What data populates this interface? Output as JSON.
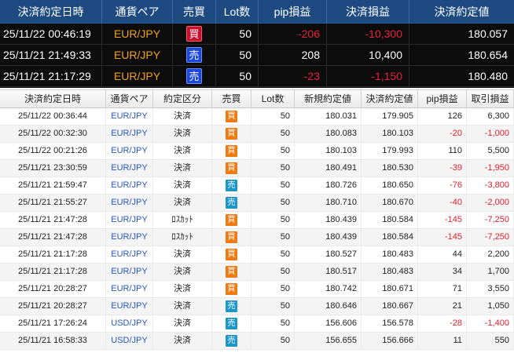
{
  "open_positions": {
    "headers": [
      "決済約定日時",
      "通貨ペア",
      "売買",
      "Lot数",
      "pip損益",
      "決済損益",
      "決済約定値"
    ],
    "rows": [
      {
        "datetime": "25/11/22 00:46:19",
        "pair": "EUR/JPY",
        "side": "買",
        "side_type": "buy",
        "lot": "50",
        "pip": "-206",
        "pnl": "-10,300",
        "price": "180.057",
        "negative": true
      },
      {
        "datetime": "25/11/21 21:49:33",
        "pair": "EUR/JPY",
        "side": "売",
        "side_type": "sell",
        "lot": "50",
        "pip": "208",
        "pnl": "10,400",
        "price": "180.654",
        "negative": false
      },
      {
        "datetime": "25/11/21 21:17:29",
        "pair": "EUR/JPY",
        "side": "売",
        "side_type": "sell",
        "lot": "50",
        "pip": "-23",
        "pnl": "-1,150",
        "price": "180.480",
        "negative": true
      }
    ]
  },
  "history": {
    "headers": [
      "決済約定日時",
      "通貨ペア",
      "約定区分",
      "売買",
      "Lot数",
      "新規約定値",
      "決済約定値",
      "pip損益",
      "取引損益"
    ],
    "rows": [
      {
        "datetime": "25/11/22 00:36:44",
        "pair": "EUR/JPY",
        "kind": "決済",
        "side": "買",
        "side_type": "buy",
        "lot": "50",
        "open": "180.031",
        "close": "179.905",
        "pip": "126",
        "pnl": "6,300",
        "negative": false
      },
      {
        "datetime": "25/11/22 00:32:30",
        "pair": "EUR/JPY",
        "kind": "決済",
        "side": "買",
        "side_type": "buy",
        "lot": "50",
        "open": "180.083",
        "close": "180.103",
        "pip": "-20",
        "pnl": "-1,000",
        "negative": true
      },
      {
        "datetime": "25/11/22 00:21:26",
        "pair": "EUR/JPY",
        "kind": "決済",
        "side": "買",
        "side_type": "buy",
        "lot": "50",
        "open": "180.103",
        "close": "179.993",
        "pip": "110",
        "pnl": "5,500",
        "negative": false
      },
      {
        "datetime": "25/11/21 23:30:59",
        "pair": "EUR/JPY",
        "kind": "決済",
        "side": "買",
        "side_type": "buy",
        "lot": "50",
        "open": "180.491",
        "close": "180.530",
        "pip": "-39",
        "pnl": "-1,950",
        "negative": true
      },
      {
        "datetime": "25/11/21 21:59:47",
        "pair": "EUR/JPY",
        "kind": "決済",
        "side": "売",
        "side_type": "sell",
        "lot": "50",
        "open": "180.726",
        "close": "180.650",
        "pip": "-76",
        "pnl": "-3,800",
        "negative": true
      },
      {
        "datetime": "25/11/21 21:55:27",
        "pair": "EUR/JPY",
        "kind": "決済",
        "side": "売",
        "side_type": "sell",
        "lot": "50",
        "open": "180.710",
        "close": "180.670",
        "pip": "-40",
        "pnl": "-2,000",
        "negative": true
      },
      {
        "datetime": "25/11/21 21:47:28",
        "pair": "EUR/JPY",
        "kind": "ﾛｽｶｯﾄ",
        "side": "買",
        "side_type": "buy",
        "lot": "50",
        "open": "180.439",
        "close": "180.584",
        "pip": "-145",
        "pnl": "-7,250",
        "negative": true
      },
      {
        "datetime": "25/11/21 21:47:28",
        "pair": "EUR/JPY",
        "kind": "ﾛｽｶｯﾄ",
        "side": "買",
        "side_type": "buy",
        "lot": "50",
        "open": "180.439",
        "close": "180.584",
        "pip": "-145",
        "pnl": "-7,250",
        "negative": true
      },
      {
        "datetime": "25/11/21 21:17:28",
        "pair": "EUR/JPY",
        "kind": "決済",
        "side": "買",
        "side_type": "buy",
        "lot": "50",
        "open": "180.527",
        "close": "180.483",
        "pip": "44",
        "pnl": "2,200",
        "negative": false
      },
      {
        "datetime": "25/11/21 21:17:28",
        "pair": "EUR/JPY",
        "kind": "決済",
        "side": "買",
        "side_type": "buy",
        "lot": "50",
        "open": "180.517",
        "close": "180.483",
        "pip": "34",
        "pnl": "1,700",
        "negative": false
      },
      {
        "datetime": "25/11/21 20:28:27",
        "pair": "EUR/JPY",
        "kind": "決済",
        "side": "買",
        "side_type": "buy",
        "lot": "50",
        "open": "180.742",
        "close": "180.671",
        "pip": "71",
        "pnl": "3,550",
        "negative": false
      },
      {
        "datetime": "25/11/21 20:28:27",
        "pair": "EUR/JPY",
        "kind": "決済",
        "side": "売",
        "side_type": "sell",
        "lot": "50",
        "open": "180.646",
        "close": "180.667",
        "pip": "21",
        "pnl": "1,050",
        "negative": false
      },
      {
        "datetime": "25/11/21 17:26:24",
        "pair": "USD/JPY",
        "kind": "決済",
        "side": "売",
        "side_type": "sell",
        "lot": "50",
        "open": "156.606",
        "close": "156.578",
        "pip": "-28",
        "pnl": "-1,400",
        "negative": true
      },
      {
        "datetime": "25/11/21 16:58:33",
        "pair": "USD/JPY",
        "kind": "決済",
        "side": "売",
        "side_type": "sell",
        "lot": "50",
        "open": "156.655",
        "close": "156.666",
        "pip": "11",
        "pnl": "550",
        "negative": false
      }
    ]
  },
  "colors": {
    "header_blue": "#1d4a80",
    "pair_orange": "#f2a20f",
    "negative_red": "#e8203a",
    "buy_badge": "#ef7a12",
    "sell_badge": "#1d97c6"
  }
}
